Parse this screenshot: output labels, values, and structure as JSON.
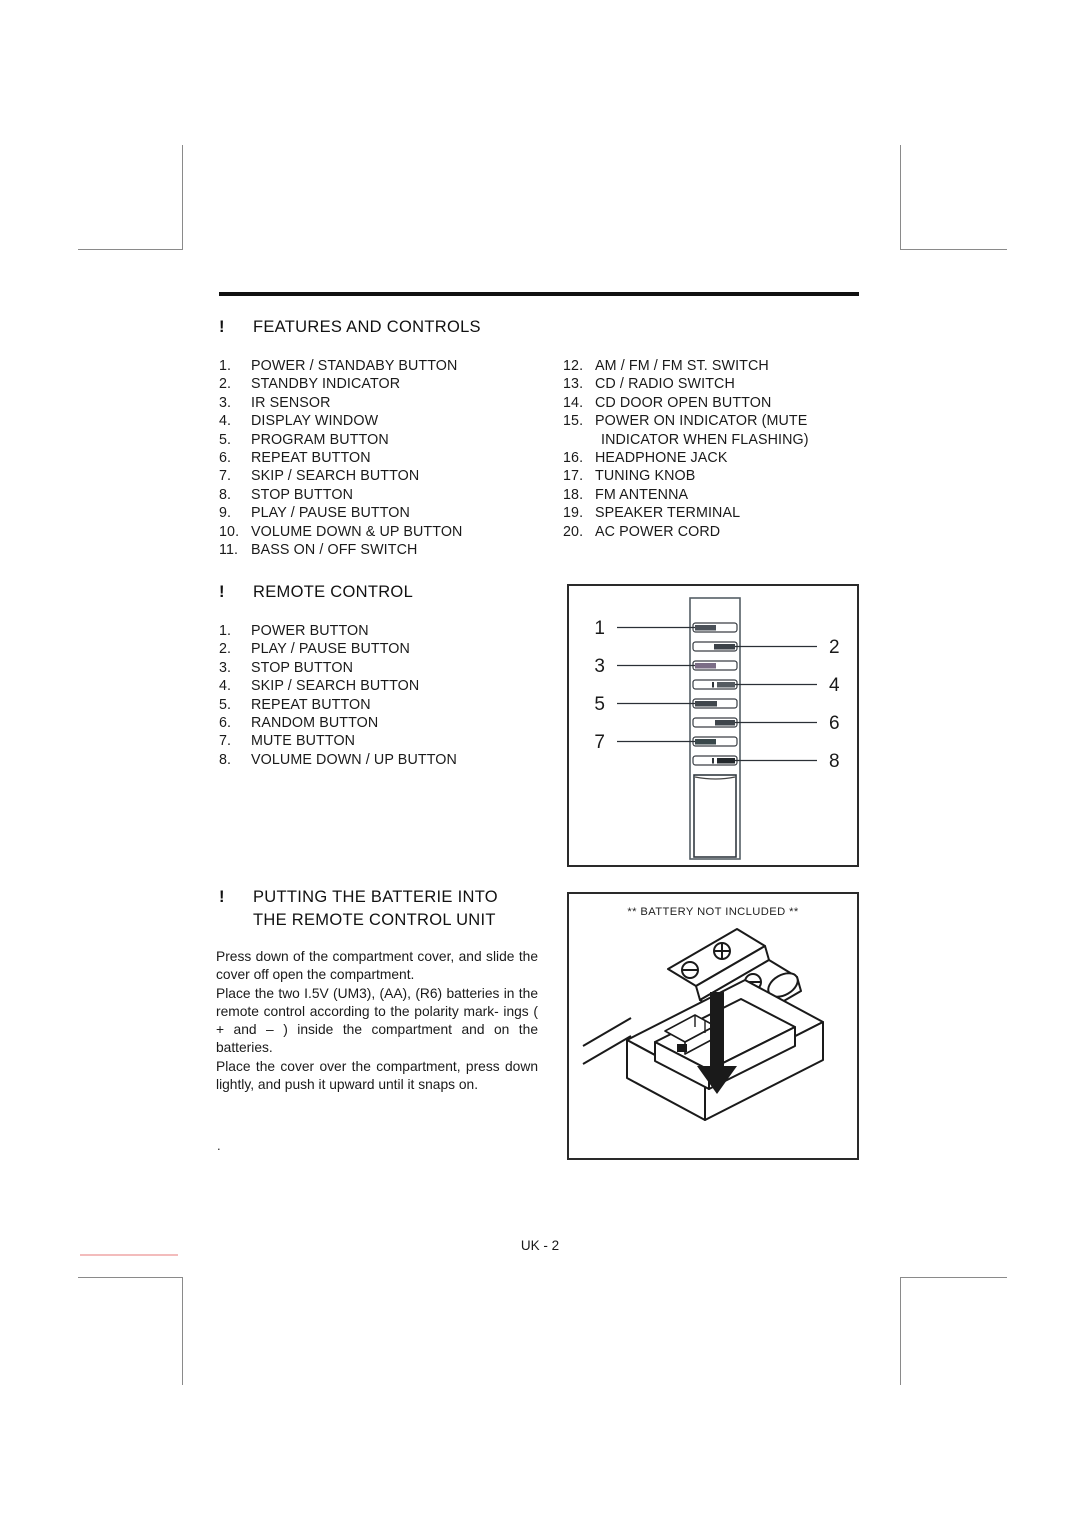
{
  "document": {
    "footer_page_label": "UK - 2"
  },
  "features_section": {
    "bullet": "!",
    "title": "FEATURES AND CONTROLS",
    "left_items": [
      {
        "num": "1.",
        "label": "POWER / STANDABY BUTTON"
      },
      {
        "num": "2.",
        "label": "STANDBY INDICATOR"
      },
      {
        "num": "3.",
        "label": "IR SENSOR"
      },
      {
        "num": "4.",
        "label": "DISPLAY WINDOW"
      },
      {
        "num": "5.",
        "label": "PROGRAM BUTTON"
      },
      {
        "num": "6.",
        "label": "REPEAT BUTTON"
      },
      {
        "num": "7.",
        "label": "SKIP / SEARCH BUTTON"
      },
      {
        "num": "8.",
        "label": "STOP BUTTON"
      },
      {
        "num": "9.",
        "label": "PLAY / PAUSE BUTTON"
      },
      {
        "num": "10.",
        "label": "VOLUME DOWN & UP BUTTON"
      },
      {
        "num": "11.",
        "label": "BASS ON / OFF SWITCH"
      }
    ],
    "right_items": [
      {
        "num": "12.",
        "label": "AM / FM / FM ST. SWITCH"
      },
      {
        "num": "13.",
        "label": "CD / RADIO SWITCH"
      },
      {
        "num": "14.",
        "label": "CD DOOR OPEN BUTTON"
      },
      {
        "num": "15.",
        "label": "POWER ON INDICATOR (MUTE"
      },
      {
        "num": "",
        "label": "INDICATOR WHEN FLASHING)",
        "continuation": true
      },
      {
        "num": "16.",
        "label": "HEADPHONE JACK"
      },
      {
        "num": "17.",
        "label": "TUNING KNOB"
      },
      {
        "num": "18.",
        "label": "FM ANTENNA"
      },
      {
        "num": "19.",
        "label": "SPEAKER TERMINAL"
      },
      {
        "num": "20.",
        "label": "AC POWER CORD"
      }
    ]
  },
  "remote_section": {
    "bullet": "!",
    "title": "REMOTE CONTROL",
    "items": [
      {
        "num": "1.",
        "label": "POWER BUTTON"
      },
      {
        "num": "2.",
        "label": "PLAY / PAUSE BUTTON"
      },
      {
        "num": "3.",
        "label": "STOP BUTTON"
      },
      {
        "num": "4.",
        "label": "SKIP / SEARCH BUTTON"
      },
      {
        "num": "5.",
        "label": "REPEAT BUTTON"
      },
      {
        "num": "6.",
        "label": "RANDOM BUTTON"
      },
      {
        "num": "7.",
        "label": "MUTE BUTTON"
      },
      {
        "num": "8.",
        "label": "VOLUME DOWN / UP BUTTON"
      }
    ],
    "figure_callouts": [
      "1",
      "2",
      "3",
      "4",
      "5",
      "6",
      "7",
      "8"
    ]
  },
  "battery_section": {
    "bullet": "!",
    "title_line1": "PUTTING THE BATTERIE INTO",
    "title_line2": "THE REMOTE CONTROL UNIT",
    "paragraphs": [
      "Press down of the compartment cover, and slide the cover off open the compartment.",
      "Place the two I.5V (UM3), (AA), (R6) batteries in the remote control according to the polarity mark- ings ( +  and  – ) inside the compartment and on the batteries.",
      "Place the cover over the compartment, press down lightly, and push it upward until it snaps on."
    ],
    "stray_mark": ".",
    "figure_note": "**  BATTERY NOT INCLUDED  **"
  },
  "colors": {
    "ink": "#1a1a1a",
    "rule": "#111111",
    "box_border": "#2a2a2a",
    "crop_mark": "#8a8a8a",
    "pink_rule": "#f3bcbc"
  }
}
